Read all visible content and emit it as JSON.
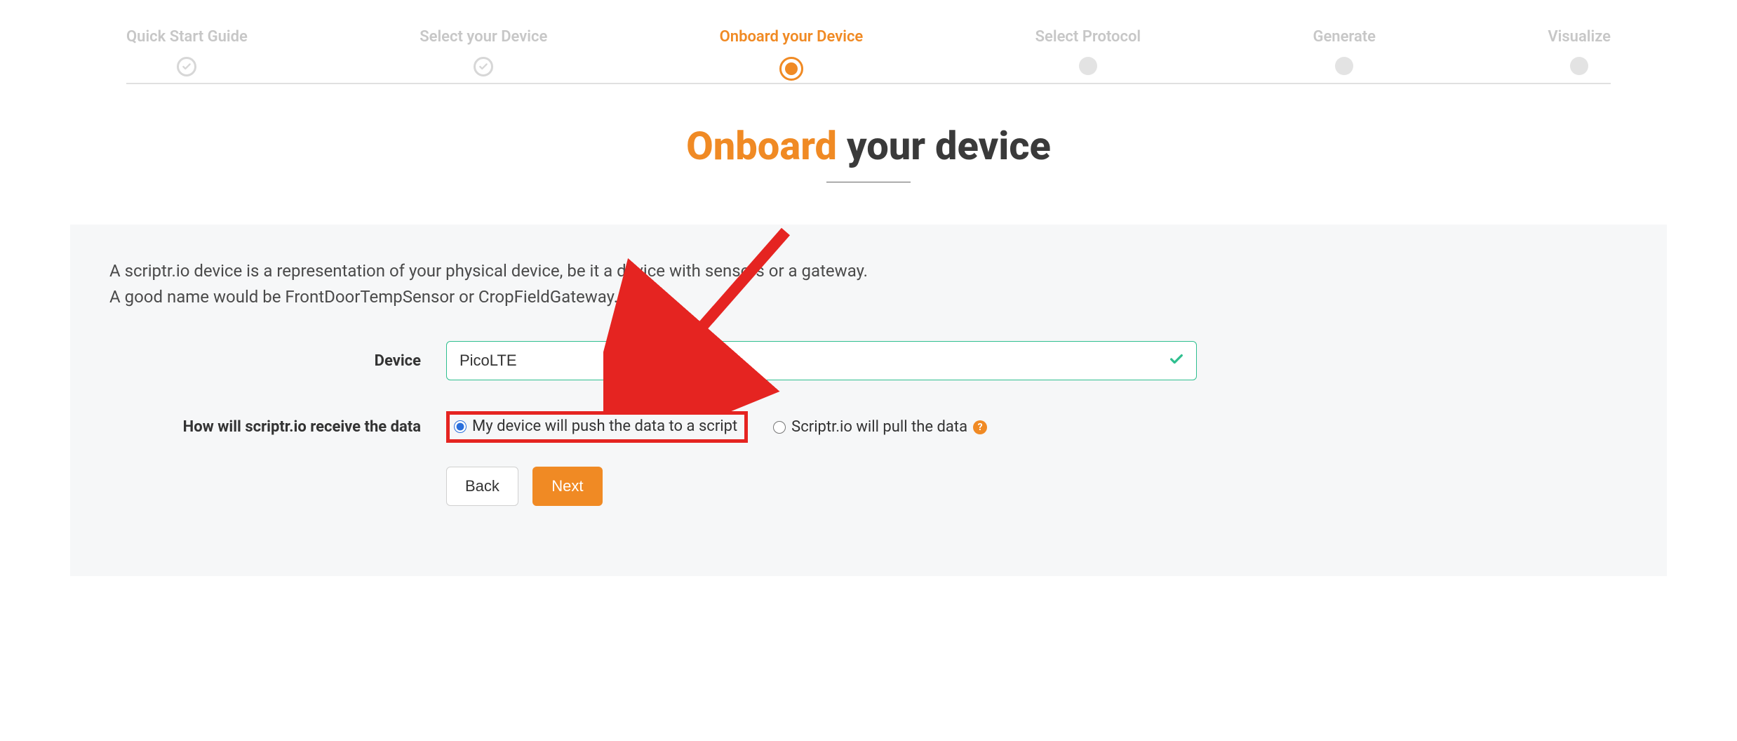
{
  "stepper": {
    "steps": [
      {
        "label": "Quick Start Guide",
        "state": "completed"
      },
      {
        "label": "Select your Device",
        "state": "completed"
      },
      {
        "label": "Onboard your Device",
        "state": "active"
      },
      {
        "label": "Select Protocol",
        "state": "future"
      },
      {
        "label": "Generate",
        "state": "future"
      },
      {
        "label": "Visualize",
        "state": "future"
      }
    ]
  },
  "title": {
    "accent": "Onboard",
    "rest": "your device"
  },
  "panel": {
    "desc_line1": "A scriptr.io device is a representation of your physical device, be it a device with sensors or a gateway.",
    "desc_line2": "A good name would be FrontDoorTempSensor or CropFieldGateway."
  },
  "form": {
    "device_label": "Device",
    "device_value": "PicoLTE",
    "receive_label": "How will scriptr.io receive the data",
    "radio_push": "My device will push the data to a script",
    "radio_pull": "Scriptr.io will pull the data",
    "help_icon": "?",
    "back_label": "Back",
    "next_label": "Next"
  },
  "colors": {
    "accent": "#f08a24",
    "success": "#2fbf8f",
    "callout": "#e52421"
  }
}
